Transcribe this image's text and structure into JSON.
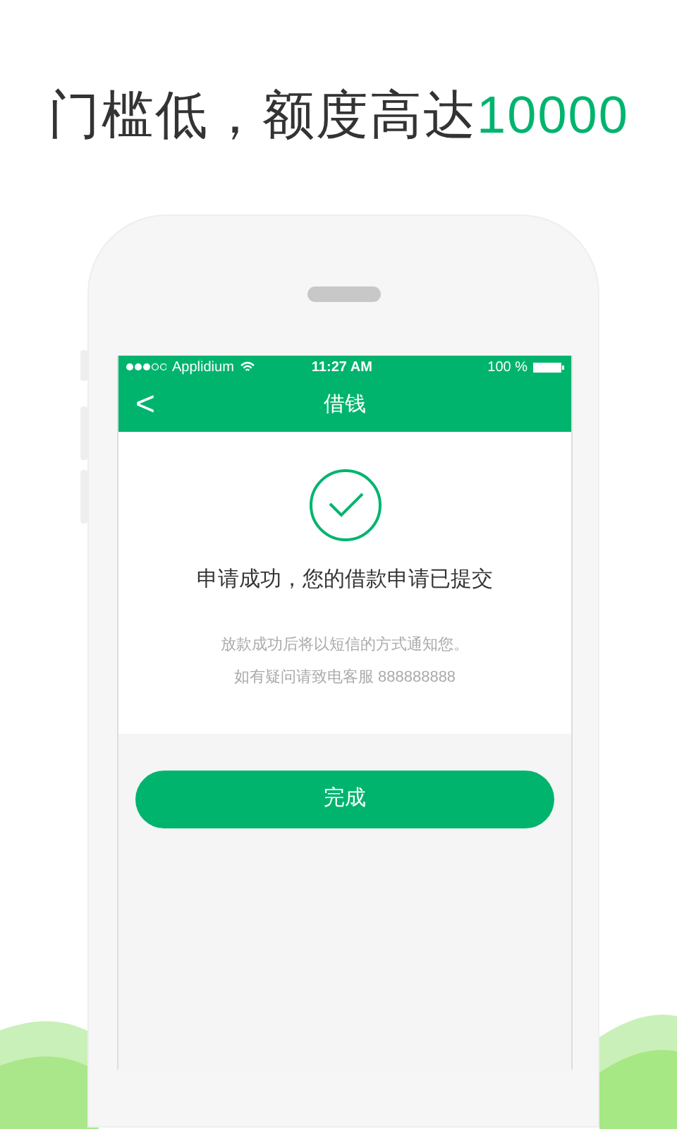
{
  "headline": {
    "text": "门槛低，额度高达",
    "highlight": "10000"
  },
  "status_bar": {
    "carrier": "Applidium",
    "time": "11:27 AM",
    "battery": "100 %"
  },
  "nav_bar": {
    "back": "<",
    "title": "借钱"
  },
  "result": {
    "message": "申请成功，您的借款申请已提交",
    "notes": [
      "放款成功后将以短信的方式通知您。",
      "如有疑问请致电客服 888888888"
    ]
  },
  "done_button": "完成"
}
